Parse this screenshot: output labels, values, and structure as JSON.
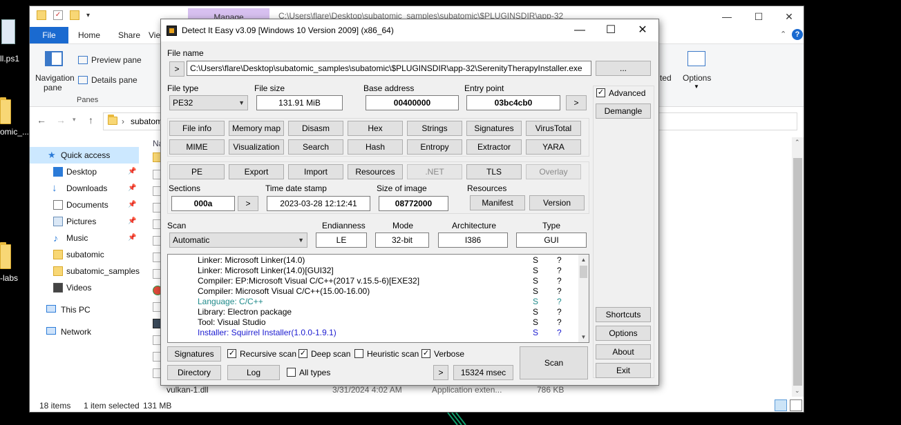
{
  "desktop": {
    "icons": [
      {
        "label": "ll.ps1"
      },
      {
        "label": "omic_..."
      },
      {
        "label": "-labs"
      }
    ]
  },
  "explorer": {
    "manage_tab": "Manage",
    "path": "C:\\Users\\flare\\Desktop\\subatomic_samples\\subatomic\\$PLUGINSDIR\\app-32",
    "ribbon_tabs": {
      "file": "File",
      "home": "Home",
      "share": "Share",
      "view": "View"
    },
    "ribbon": {
      "navigation_pane": "Navigation",
      "navigation_pane2": "pane",
      "preview_pane": "Preview pane",
      "details_pane": "Details pane",
      "panes_group": "Panes",
      "hidden_items": "ted",
      "options": "Options"
    },
    "address_crumb": "subatom",
    "col_header": "Na",
    "nav": {
      "quick_access": "Quick access",
      "items": [
        {
          "label": "Desktop"
        },
        {
          "label": "Downloads"
        },
        {
          "label": "Documents"
        },
        {
          "label": "Pictures"
        },
        {
          "label": "Music"
        },
        {
          "label": "subatomic"
        },
        {
          "label": "subatomic_samples"
        },
        {
          "label": "Videos"
        }
      ],
      "this_pc": "This PC",
      "network": "Network"
    },
    "last_file": {
      "name": "vulkan-1.dll",
      "date": "3/31/2024 4:02 AM",
      "type": "Application exten...",
      "size": "786 KB"
    },
    "status": {
      "items": "18 items",
      "selected": "1 item selected",
      "size": "131 MB"
    }
  },
  "die": {
    "title": "Detect It Easy v3.09 [Windows 10 Version 2009] (x86_64)",
    "file_name_label": "File name",
    "file_path": "C:\\Users\\flare\\Desktop\\subatomic_samples\\subatomic\\$PLUGINSDIR\\app-32\\SerenityTherapyInstaller.exe",
    "browse_button": "...",
    "nav_arrow": ">",
    "file_type_label": "File type",
    "file_type": "PE32",
    "file_size_label": "File size",
    "file_size": "131.91 MiB",
    "base_address_label": "Base address",
    "base_address": "00400000",
    "entry_point_label": "Entry point",
    "entry_point": "03bc4cb0",
    "advanced_label": "Advanced",
    "demangle_button": "Demangle",
    "tool_buttons_row1": [
      "File info",
      "Memory map",
      "Disasm",
      "Hex",
      "Strings",
      "Signatures",
      "VirusTotal"
    ],
    "tool_buttons_row2": [
      "MIME",
      "Visualization",
      "Search",
      "Hash",
      "Entropy",
      "Extractor",
      "YARA"
    ],
    "pe_buttons": [
      "PE",
      "Export",
      "Import",
      "Resources",
      ".NET",
      "TLS",
      "Overlay"
    ],
    "sections_label": "Sections",
    "sections": "000a",
    "time_date_stamp_label": "Time date stamp",
    "time_date_stamp": "2023-03-28 12:12:41",
    "size_of_image_label": "Size of image",
    "size_of_image": "08772000",
    "resources_label": "Resources",
    "manifest_button": "Manifest",
    "version_button": "Version",
    "scan_label": "Scan",
    "scan_mode": "Automatic",
    "endianness_label": "Endianness",
    "endianness": "LE",
    "mode_label": "Mode",
    "mode": "32-bit",
    "architecture_label": "Architecture",
    "architecture": "I386",
    "type_label": "Type",
    "type": "GUI",
    "results": [
      {
        "name": "Linker: Microsoft Linker(14.0)",
        "s": "S",
        "q": "?",
        "color": "#000000"
      },
      {
        "name": "Linker: Microsoft Linker(14.0)[GUI32]",
        "s": "S",
        "q": "?",
        "color": "#000000"
      },
      {
        "name": "Compiler: EP:Microsoft Visual C/C++(2017 v.15.5-6)[EXE32]",
        "s": "S",
        "q": "?",
        "color": "#000000"
      },
      {
        "name": "Compiler: Microsoft Visual C/C++(15.00-16.00)",
        "s": "S",
        "q": "?",
        "color": "#000000"
      },
      {
        "name": "Language: C/C++",
        "s": "S",
        "q": "?",
        "color": "#1f8a8a"
      },
      {
        "name": "Library: Electron package",
        "s": "S",
        "q": "?",
        "color": "#000000"
      },
      {
        "name": "Tool: Visual Studio",
        "s": "S",
        "q": "?",
        "color": "#000000"
      },
      {
        "name": "Installer: Squirrel Installer(1.0.0-1.9.1)",
        "s": "S",
        "q": "?",
        "color": "#1a1ad0"
      }
    ],
    "signatures_button": "Signatures",
    "recursive_scan": "Recursive scan",
    "deep_scan": "Deep scan",
    "heuristic_scan": "Heuristic scan",
    "verbose": "Verbose",
    "scan_button": "Scan",
    "directory_button": "Directory",
    "log_button": "Log",
    "all_types": "All types",
    "time_arrow": ">",
    "elapsed": "15324 msec",
    "shortcuts_button": "Shortcuts",
    "options_button": "Options",
    "about_button": "About",
    "exit_button": "Exit"
  }
}
